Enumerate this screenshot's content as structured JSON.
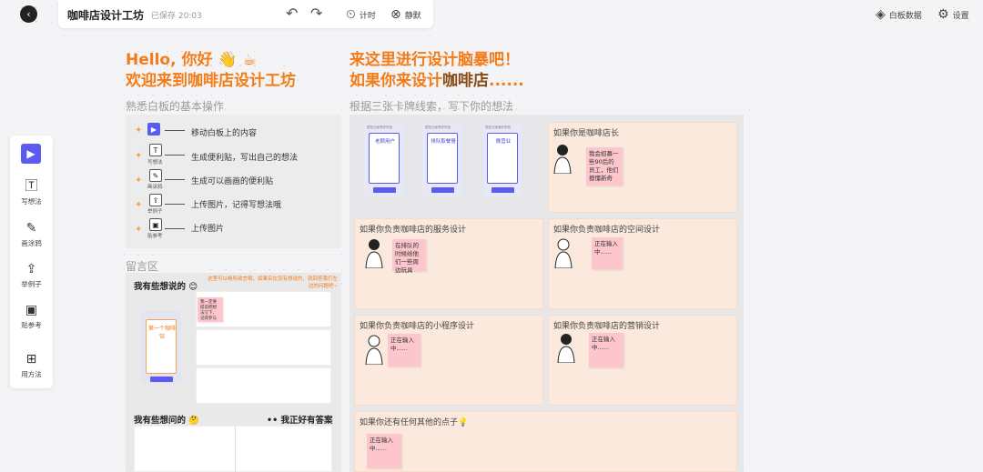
{
  "topbar": {
    "title": "咖啡店设计工坊",
    "saved": "已保存 20:03",
    "back_icon": "‹",
    "undo_icon": "↶",
    "redo_icon": "↷",
    "timer": "计时",
    "mute": "静默",
    "board_data": "白板数据",
    "settings": "设置"
  },
  "toolbar": {
    "items": [
      {
        "label": "写想法",
        "icon": "🅃"
      },
      {
        "label": "画涂鸦",
        "icon": "✎"
      },
      {
        "label": "举例子",
        "icon": "⇪"
      },
      {
        "label": "贴参考",
        "icon": "▣"
      },
      {
        "label": "用方法",
        "icon": "⊞"
      }
    ]
  },
  "intro": {
    "line1": "Hello, 你好 👋 ☕",
    "line2": "欢迎来到咖啡店设计工坊",
    "subtitle": "熟悉白板的基本操作",
    "ops": [
      {
        "text": "移动白板上的内容",
        "label": ""
      },
      {
        "text": "生成便利贴，写出自己的想法",
        "label": "写想法"
      },
      {
        "text": "生成可以画画的便利贴",
        "label": "画涂鸦"
      },
      {
        "text": "上传图片，记得写想法哦",
        "label": "举例子"
      },
      {
        "text": "上传图片",
        "label": "贴参考"
      }
    ]
  },
  "brainstorm": {
    "line1": "来这里进行设计脑暴吧！",
    "line2a": "如果你来设计",
    "line2b": "咖啡店",
    "line2c": "......",
    "subtitle": "根据三张卡牌线索，写下你的想法",
    "phones": [
      {
        "title": "老顾用户",
        "header": "现在已经有好东西"
      },
      {
        "title": "排队取餐慢",
        "header": "现在已经有好东西"
      },
      {
        "title": "晚营业",
        "header": "现在已经有好东西"
      }
    ],
    "cards": [
      {
        "title": "如果你是咖啡店长",
        "note": "我会招募一些90后的员工，他们擅懂新奇"
      },
      {
        "title": "如果你负责咖啡店的服务设计",
        "note": "在排队的时候给他们一些周边玩具"
      },
      {
        "title": "如果你负责咖啡店的空间设计",
        "note": "正在输入中......"
      },
      {
        "title": "如果你负责咖啡店的小程序设计",
        "note": "正在输入中......"
      },
      {
        "title": "如果你负责咖啡店的营销设计",
        "note": "正在输入中......"
      },
      {
        "title": "如果你还有任何其他的点子💡",
        "note": "正在输入中......"
      }
    ]
  },
  "board": {
    "title": "留言区",
    "want_say": "我有些想说的 😊",
    "hint": "这里可以畅所欲言哦，如果实在没有想说的，就回答我们左边的问题吧~",
    "note": "我一定要提前把想法写下，记得参与",
    "phone_title": "第一个咖啡馆",
    "want_ask": "我有些想问的 🤔",
    "answer": "•• 我正好有答案"
  }
}
